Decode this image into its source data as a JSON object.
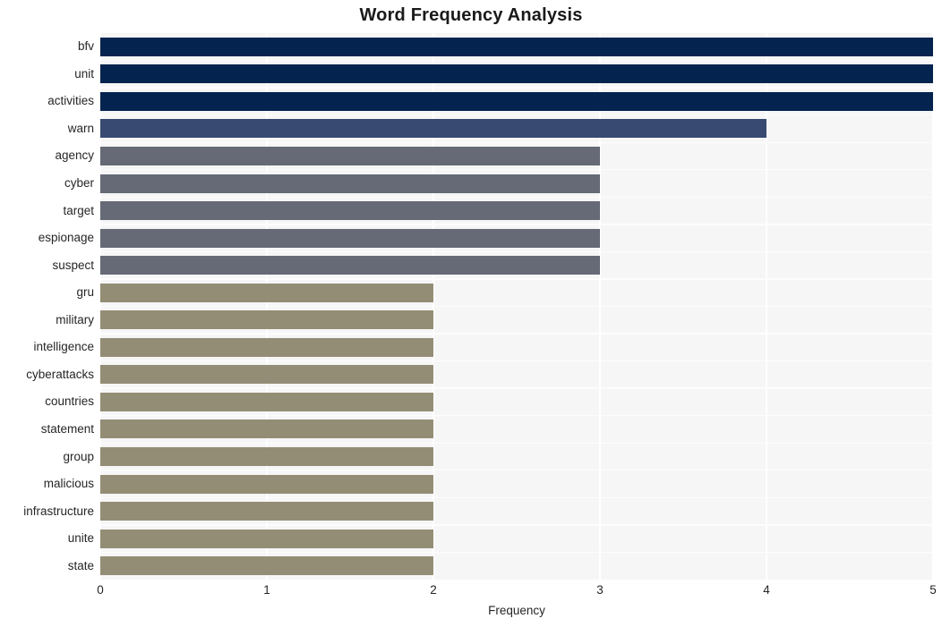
{
  "chart_data": {
    "type": "bar",
    "orientation": "horizontal",
    "title": "Word Frequency Analysis",
    "xlabel": "Frequency",
    "ylabel": "",
    "xlim": [
      0,
      5
    ],
    "xticks": [
      "0",
      "1",
      "2",
      "3",
      "4",
      "5"
    ],
    "grid": true,
    "legend": "none",
    "categories": [
      "bfv",
      "unit",
      "activities",
      "warn",
      "agency",
      "cyber",
      "target",
      "espionage",
      "suspect",
      "gru",
      "military",
      "intelligence",
      "cyberattacks",
      "countries",
      "statement",
      "group",
      "malicious",
      "infrastructure",
      "unite",
      "state"
    ],
    "values": [
      5,
      5,
      5,
      4,
      3,
      3,
      3,
      3,
      3,
      2,
      2,
      2,
      2,
      2,
      2,
      2,
      2,
      2,
      2,
      2
    ],
    "bar_colors": [
      "#04234e",
      "#04234e",
      "#04234e",
      "#394a72",
      "#656a76",
      "#656a76",
      "#656a76",
      "#656a76",
      "#656a76",
      "#948d75",
      "#948d75",
      "#948d75",
      "#948d75",
      "#948d75",
      "#948d75",
      "#948d75",
      "#948d75",
      "#948d75",
      "#948d75",
      "#948d75"
    ],
    "plot_background": "#f6f6f7",
    "figure_background": "#ffffff",
    "gridline_color": "#ffffff"
  }
}
